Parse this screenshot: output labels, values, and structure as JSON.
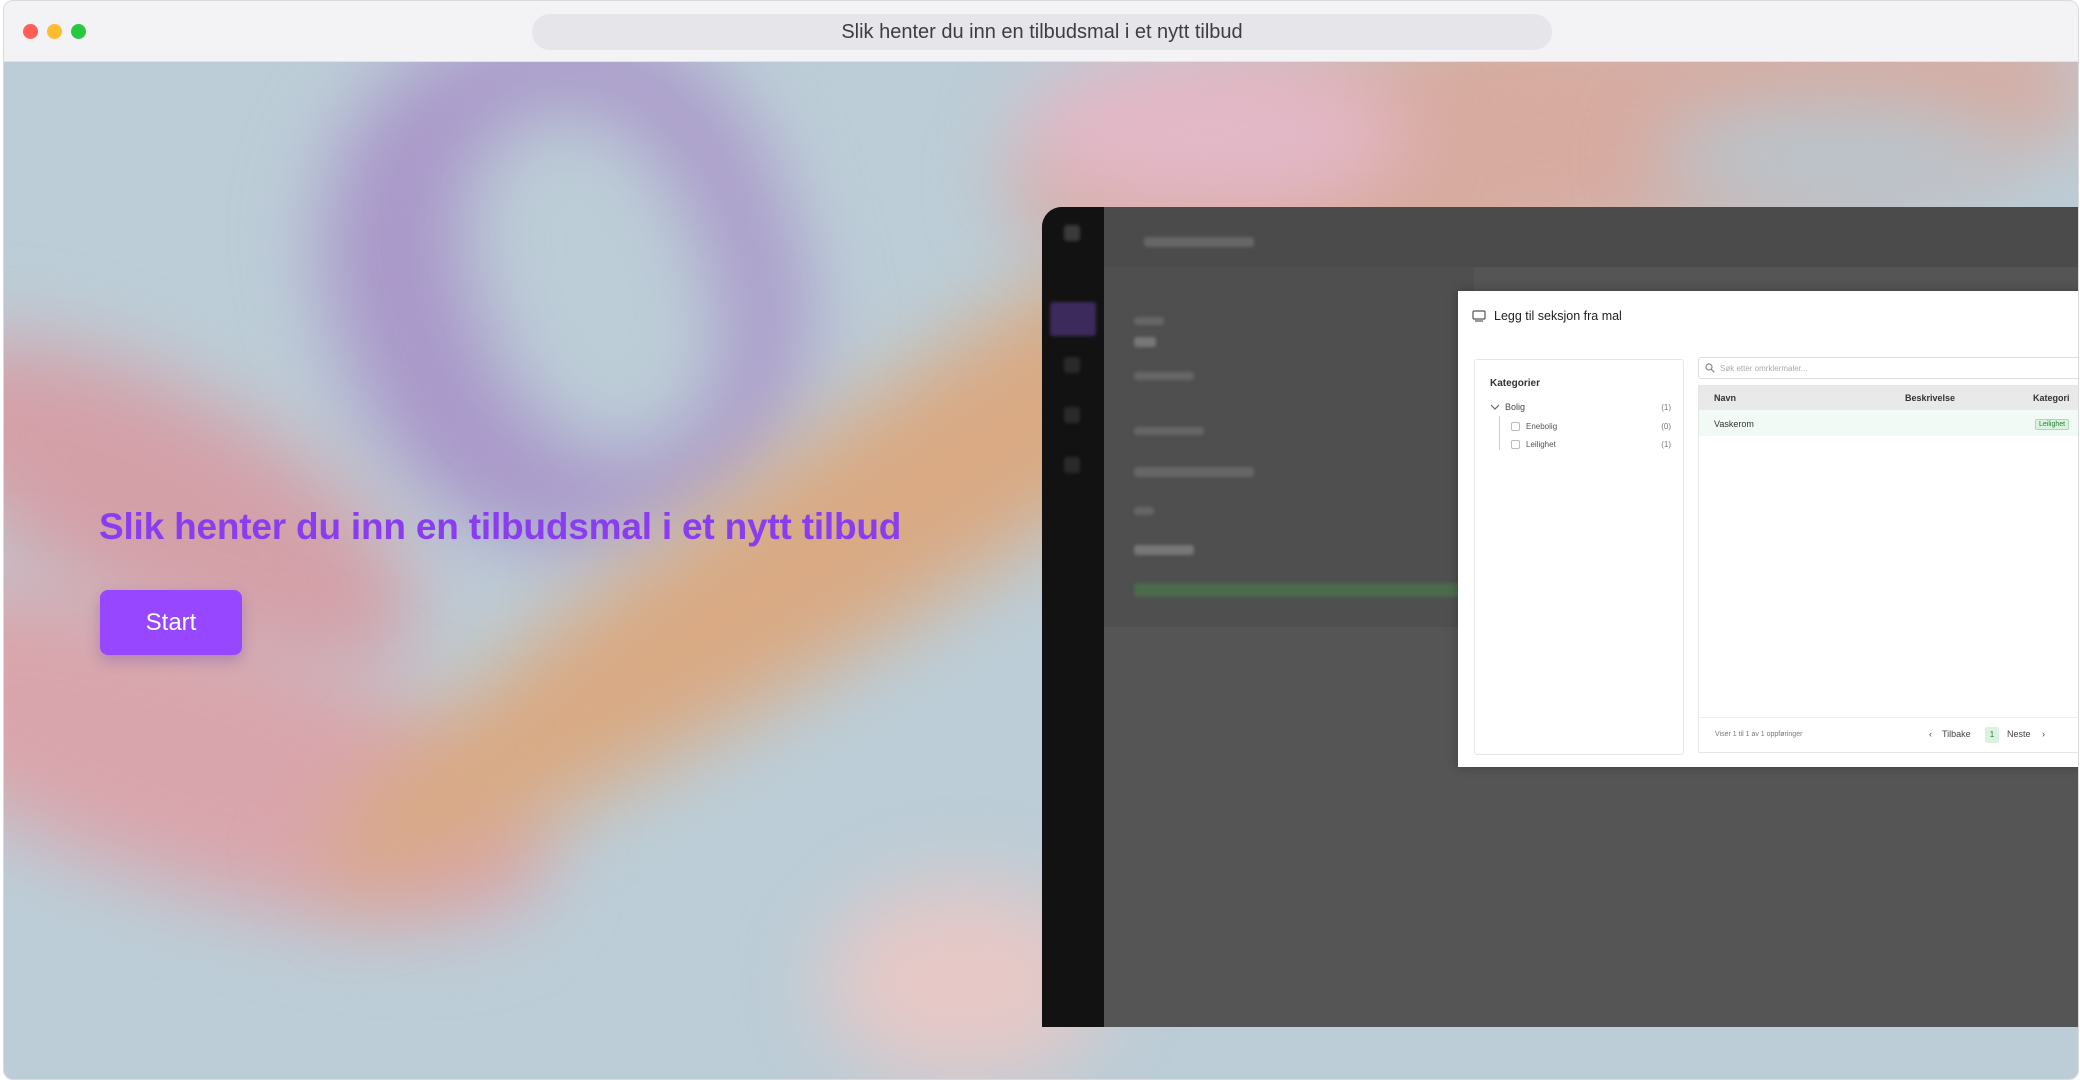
{
  "window": {
    "url_title": "Slik henter du inn en tilbudsmal i et nytt tilbud"
  },
  "hero": {
    "headline": "Slik henter du inn en tilbudsmal i et nytt tilbud",
    "start_label": "Start",
    "accent": "#9747ff"
  },
  "modal": {
    "title": "Legg til seksjon fra mal",
    "categories": {
      "heading": "Kategorier",
      "items": [
        {
          "label": "Bolig",
          "count": "(1)"
        },
        {
          "label": "Enebolig",
          "count": "(0)"
        },
        {
          "label": "Leilighet",
          "count": "(1)"
        }
      ]
    },
    "search_placeholder": "Søk etter omrklermaler...",
    "table": {
      "columns": [
        "Navn",
        "Beskrivelse",
        "Kategori"
      ],
      "rows": [
        {
          "navn": "Vaskerom",
          "beskrivelse": "",
          "kategori": "Leilighet"
        }
      ]
    },
    "pagination": {
      "info": "Viser 1 til 1 av 1 oppføringer",
      "prev_label": "Tilbake",
      "current_page": "1",
      "next_label": "Neste"
    }
  }
}
